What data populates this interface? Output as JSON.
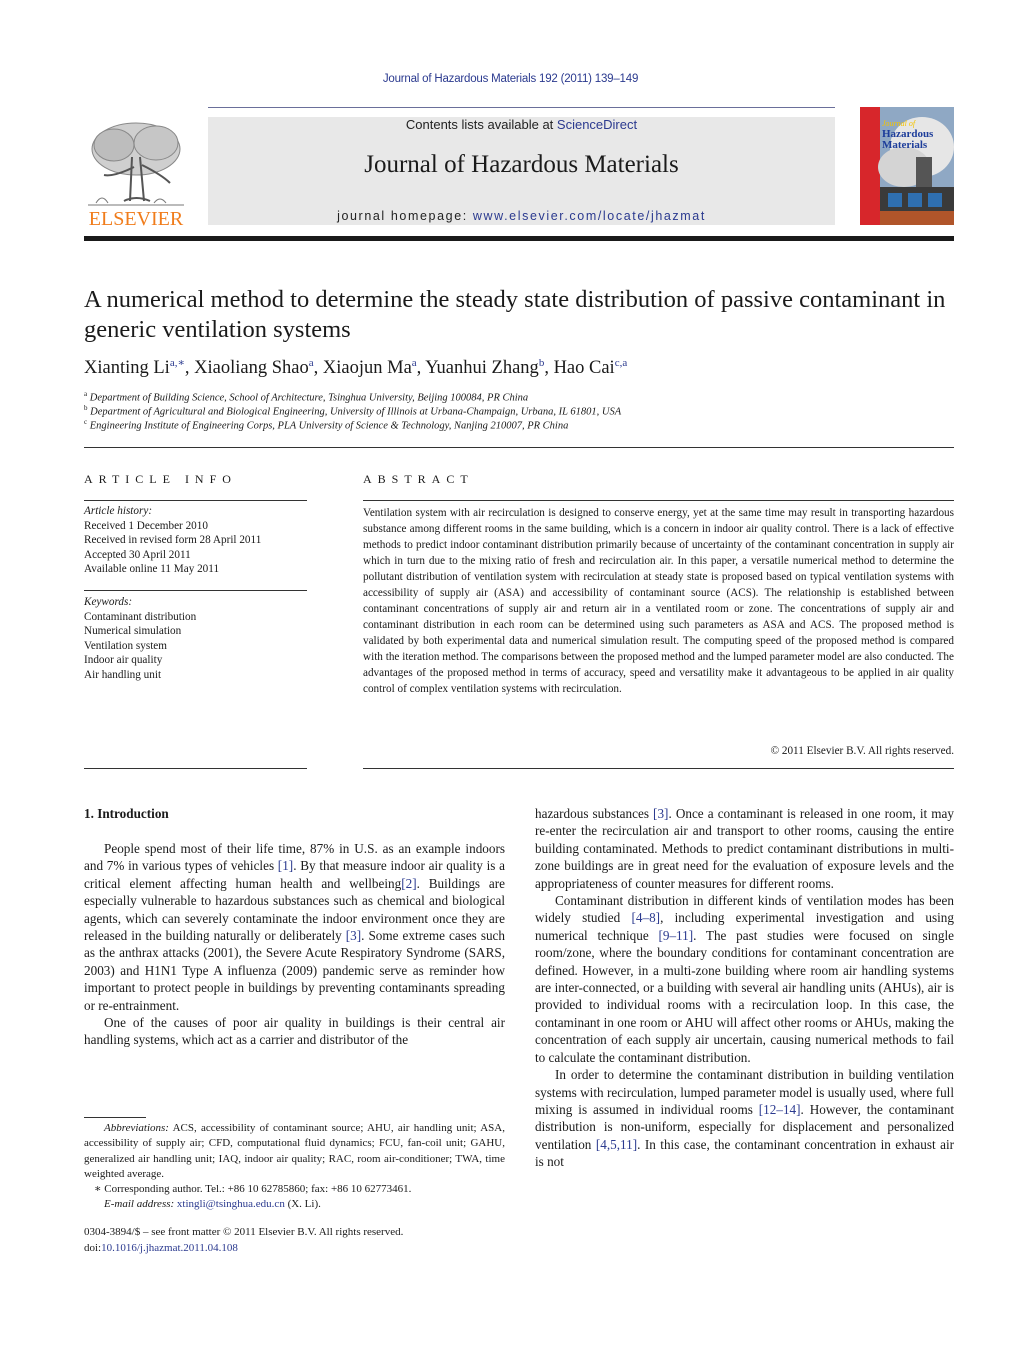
{
  "header": {
    "journal_reference": "Journal of Hazardous Materials 192 (2011) 139–149",
    "contents_prefix": "Contents lists available at ",
    "contents_link": "ScienceDirect",
    "journal_title": "Journal of Hazardous Materials",
    "homepage_prefix": "journal homepage: ",
    "homepage_link": "www.elsevier.com/locate/jhazmat",
    "publisher_logo_text": "ELSEVIER",
    "cover_title_lines": [
      "Journal of",
      "Hazardous",
      "Materials"
    ],
    "colors": {
      "link": "#2b3a8f",
      "elsevier_orange": "#f07c1b",
      "cover_red": "#d7262b",
      "banner_bg": "#e8e8e8"
    }
  },
  "article": {
    "title": "A numerical method to determine the steady state distribution of passive contaminant in generic ventilation systems",
    "authors": [
      {
        "name": "Xianting Li",
        "sup": "a,∗"
      },
      {
        "name": "Xiaoliang Shao",
        "sup": "a"
      },
      {
        "name": "Xiaojun Ma",
        "sup": "a"
      },
      {
        "name": "Yuanhui Zhang",
        "sup": "b"
      },
      {
        "name": "Hao Cai",
        "sup": "c,a"
      }
    ],
    "affiliations": [
      {
        "mark": "a",
        "text": "Department of Building Science, School of Architecture, Tsinghua University, Beijing 100084, PR China"
      },
      {
        "mark": "b",
        "text": "Department of Agricultural and Biological Engineering, University of Illinois at Urbana-Champaign, Urbana, IL 61801, USA"
      },
      {
        "mark": "c",
        "text": "Engineering Institute of Engineering Corps, PLA University of Science & Technology, Nanjing 210007, PR China"
      }
    ]
  },
  "article_info": {
    "heading": "ARTICLE INFO",
    "history_label": "Article history:",
    "history": [
      "Received 1 December 2010",
      "Received in revised form 28 April 2011",
      "Accepted 30 April 2011",
      "Available online 11 May 2011"
    ],
    "keywords_label": "Keywords:",
    "keywords": [
      "Contaminant distribution",
      "Numerical simulation",
      "Ventilation system",
      "Indoor air quality",
      "Air handling unit"
    ]
  },
  "abstract": {
    "heading": "ABSTRACT",
    "text": "Ventilation system with air recirculation is designed to conserve energy, yet at the same time may result in transporting hazardous substance among different rooms in the same building, which is a concern in indoor air quality control. There is a lack of effective methods to predict indoor contaminant distribution primarily because of uncertainty of the contaminant concentration in supply air which in turn due to the mixing ratio of fresh and recirculation air. In this paper, a versatile numerical method to determine the pollutant distribution of ventilation system with recirculation at steady state is proposed based on typical ventilation systems with accessibility of supply air (ASA) and accessibility of contaminant source (ACS). The relationship is established between contaminant concentrations of supply air and return air in a ventilated room or zone. The concentrations of supply air and contaminant distribution in each room can be determined using such parameters as ASA and ACS. The proposed method is validated by both experimental data and numerical simulation result. The computing speed of the proposed method is compared with the iteration method. The comparisons between the proposed method and the lumped parameter model are also conducted. The advantages of the proposed method in terms of accuracy, speed and versatility make it advantageous to be applied in air quality control of complex ventilation systems with recirculation.",
    "copyright": "© 2011 Elsevier B.V. All rights reserved."
  },
  "body": {
    "section_heading": "1.  Introduction",
    "left_paragraphs": [
      [
        {
          "t": "People spend most of their life time, 87% in U.S. as an example indoors and 7% in various types of vehicles "
        },
        {
          "t": "[1]",
          "link": true
        },
        {
          "t": ". By that measure indoor air quality is a critical element affecting human health and wellbeing"
        },
        {
          "t": "[2]",
          "link": true
        },
        {
          "t": ". Buildings are especially vulnerable to hazardous substances such as chemical and biological agents, which can severely contaminate the indoor environment once they are released in the building naturally or deliberately "
        },
        {
          "t": "[3]",
          "link": true
        },
        {
          "t": ". Some extreme cases such as the anthrax attacks (2001), the Severe Acute Respiratory Syndrome (SARS, 2003) and H1N1 Type A influenza (2009) pandemic serve as reminder how important to protect people in buildings by preventing contaminants spreading or re-entrainment."
        }
      ],
      [
        {
          "t": "One of the causes of poor air quality in buildings is their central air handling systems, which act as a carrier and distributor of the"
        }
      ]
    ],
    "right_paragraphs": [
      [
        {
          "t": "hazardous substances "
        },
        {
          "t": "[3]",
          "link": true
        },
        {
          "t": ". Once a contaminant is released in one room, it may re-enter the recirculation air and transport to other rooms, causing the entire building contaminated. Methods to predict contaminant distributions in multi-zone buildings are in great need for the evaluation of exposure levels and the appropriateness of counter measures for different rooms."
        }
      ],
      [
        {
          "t": "Contaminant distribution in different kinds of ventilation modes has been widely studied "
        },
        {
          "t": "[4–8]",
          "link": true
        },
        {
          "t": ", including experimental investigation and using numerical technique "
        },
        {
          "t": "[9–11]",
          "link": true
        },
        {
          "t": ". The past studies were focused on single room/zone, where the boundary conditions for contaminant concentration are defined. However, in a multi-zone building where room air handling systems are inter-connected, or a building with several air handling units (AHUs), air is provided to individual rooms with a recirculation loop. In this case, the contaminant in one room or AHU will affect other rooms or AHUs, making the concentration of each supply air uncertain, causing numerical methods to fail to calculate the contaminant distribution."
        }
      ],
      [
        {
          "t": "In order to determine the contaminant distribution in building ventilation systems with recirculation, lumped parameter model is usually used, where full mixing is assumed in individual rooms "
        },
        {
          "t": "[12–14]",
          "link": true
        },
        {
          "t": ". However, the contaminant distribution is non-uniform, especially for displacement and personalized ventilation "
        },
        {
          "t": "[4,5,11]",
          "link": true
        },
        {
          "t": ". In this case, the contaminant concentration in exhaust air is not"
        }
      ]
    ]
  },
  "footnotes": {
    "abbreviations_label": "Abbreviations:",
    "abbreviations_text": " ACS, accessibility of contaminant source; AHU, air handling unit; ASA, accessibility of supply air; CFD, computational fluid dynamics; FCU, fan-coil unit; GAHU, generalized air handling unit; IAQ, indoor air quality; RAC, room air-conditioner; TWA, time weighted average.",
    "corresponding": "∗ Corresponding author. Tel.: +86 10 62785860; fax: +86 10 62773461.",
    "email_label": "E-mail address:",
    "email": "xtingli@tsinghua.edu.cn",
    "email_suffix": " (X. Li).",
    "front_matter": "0304-3894/$ – see front matter © 2011 Elsevier B.V. All rights reserved.",
    "doi_prefix": "doi:",
    "doi": "10.1016/j.jhazmat.2011.04.108"
  }
}
